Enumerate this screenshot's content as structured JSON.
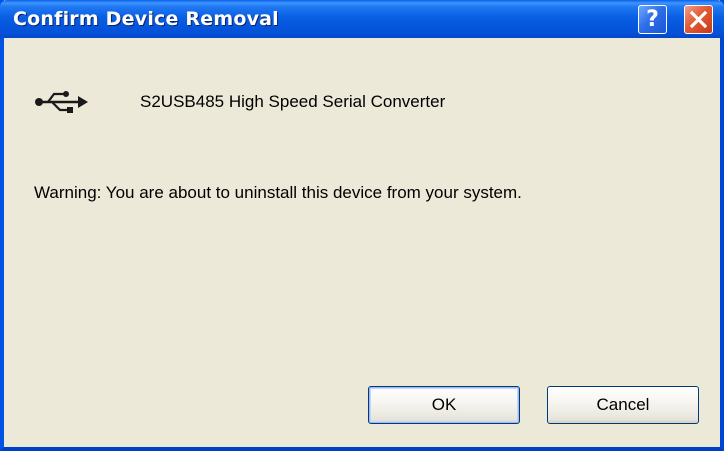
{
  "window": {
    "title": "Confirm Device Removal",
    "help_glyph": "?"
  },
  "device": {
    "icon": "usb-icon",
    "name": "S2USB485 High Speed Serial Converter"
  },
  "warning_text": "Warning: You are about to uninstall this device from your system.",
  "buttons": {
    "ok_label": "OK",
    "cancel_label": "Cancel"
  },
  "colors": {
    "titlebar": "#0a5fe3",
    "dialog_background": "#ece9d8",
    "close_button": "#e25a34",
    "help_button": "#2f6fe8"
  }
}
